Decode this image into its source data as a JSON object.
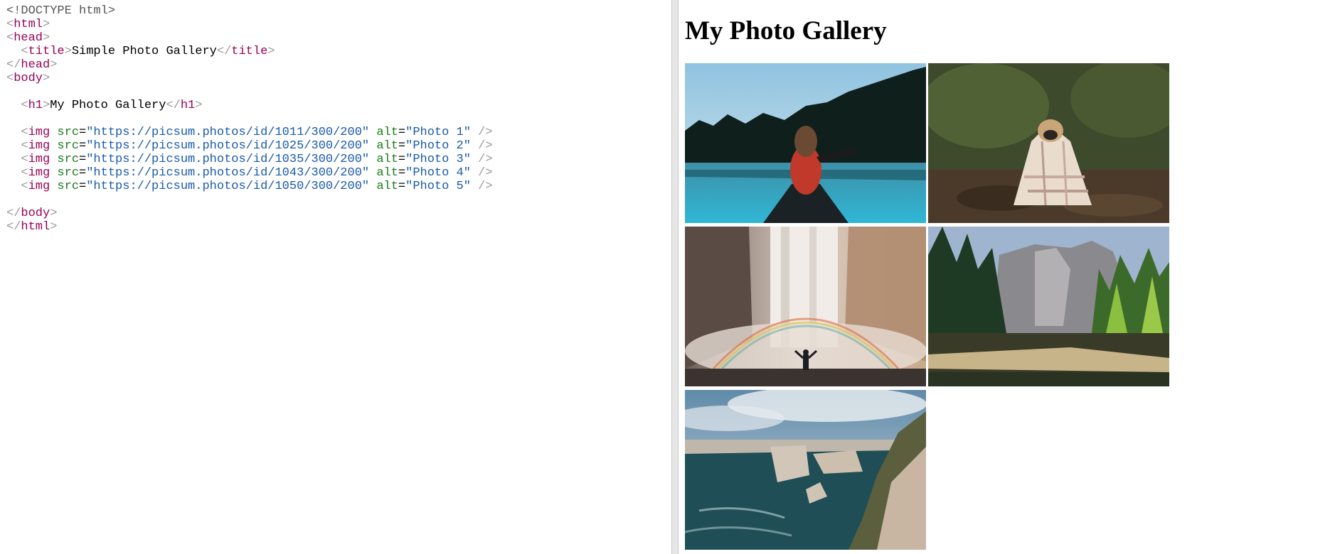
{
  "editor": {
    "lines": [
      [
        [
          "t-doc",
          "<!DOCTYPE html>"
        ]
      ],
      [
        [
          "t-br",
          "<"
        ],
        [
          "t-tag",
          "html"
        ],
        [
          "t-br",
          ">"
        ]
      ],
      [
        [
          "t-br",
          "<"
        ],
        [
          "t-tag",
          "head"
        ],
        [
          "t-br",
          ">"
        ]
      ],
      [
        [
          "t-txt",
          "  "
        ],
        [
          "t-br",
          "<"
        ],
        [
          "t-tag",
          "title"
        ],
        [
          "t-br",
          ">"
        ],
        [
          "t-txt",
          "Simple Photo Gallery"
        ],
        [
          "t-br",
          "</"
        ],
        [
          "t-tag",
          "title"
        ],
        [
          "t-br",
          ">"
        ]
      ],
      [
        [
          "t-br",
          "</"
        ],
        [
          "t-tag",
          "head"
        ],
        [
          "t-br",
          ">"
        ]
      ],
      [
        [
          "t-br",
          "<"
        ],
        [
          "t-tag",
          "body"
        ],
        [
          "t-br",
          ">"
        ]
      ],
      [
        [
          "t-txt",
          ""
        ]
      ],
      [
        [
          "t-txt",
          "  "
        ],
        [
          "t-br",
          "<"
        ],
        [
          "t-tag",
          "h1"
        ],
        [
          "t-br",
          ">"
        ],
        [
          "t-txt",
          "My Photo Gallery"
        ],
        [
          "t-br",
          "</"
        ],
        [
          "t-tag",
          "h1"
        ],
        [
          "t-br",
          ">"
        ]
      ],
      [
        [
          "t-txt",
          ""
        ]
      ],
      [
        [
          "t-txt",
          "  "
        ],
        [
          "t-br",
          "<"
        ],
        [
          "t-tag",
          "img"
        ],
        [
          "t-txt",
          " "
        ],
        [
          "t-attr",
          "src"
        ],
        [
          "t-txt",
          "="
        ],
        [
          "t-str",
          "\"https://picsum.photos/id/1011/300/200\""
        ],
        [
          "t-txt",
          " "
        ],
        [
          "t-attr",
          "alt"
        ],
        [
          "t-txt",
          "="
        ],
        [
          "t-str",
          "\"Photo 1\""
        ],
        [
          "t-txt",
          " "
        ],
        [
          "t-br",
          "/>"
        ]
      ],
      [
        [
          "t-txt",
          "  "
        ],
        [
          "t-br",
          "<"
        ],
        [
          "t-tag",
          "img"
        ],
        [
          "t-txt",
          " "
        ],
        [
          "t-attr",
          "src"
        ],
        [
          "t-txt",
          "="
        ],
        [
          "t-str",
          "\"https://picsum.photos/id/1025/300/200\""
        ],
        [
          "t-txt",
          " "
        ],
        [
          "t-attr",
          "alt"
        ],
        [
          "t-txt",
          "="
        ],
        [
          "t-str",
          "\"Photo 2\""
        ],
        [
          "t-txt",
          " "
        ],
        [
          "t-br",
          "/>"
        ]
      ],
      [
        [
          "t-txt",
          "  "
        ],
        [
          "t-br",
          "<"
        ],
        [
          "t-tag",
          "img"
        ],
        [
          "t-txt",
          " "
        ],
        [
          "t-attr",
          "src"
        ],
        [
          "t-txt",
          "="
        ],
        [
          "t-str",
          "\"https://picsum.photos/id/1035/300/200\""
        ],
        [
          "t-txt",
          " "
        ],
        [
          "t-attr",
          "alt"
        ],
        [
          "t-txt",
          "="
        ],
        [
          "t-str",
          "\"Photo 3\""
        ],
        [
          "t-txt",
          " "
        ],
        [
          "t-br",
          "/>"
        ]
      ],
      [
        [
          "t-txt",
          "  "
        ],
        [
          "t-br",
          "<"
        ],
        [
          "t-tag",
          "img"
        ],
        [
          "t-txt",
          " "
        ],
        [
          "t-attr",
          "src"
        ],
        [
          "t-txt",
          "="
        ],
        [
          "t-str",
          "\"https://picsum.photos/id/1043/300/200\""
        ],
        [
          "t-txt",
          " "
        ],
        [
          "t-attr",
          "alt"
        ],
        [
          "t-txt",
          "="
        ],
        [
          "t-str",
          "\"Photo 4\""
        ],
        [
          "t-txt",
          " "
        ],
        [
          "t-br",
          "/>"
        ]
      ],
      [
        [
          "t-txt",
          "  "
        ],
        [
          "t-br",
          "<"
        ],
        [
          "t-tag",
          "img"
        ],
        [
          "t-txt",
          " "
        ],
        [
          "t-attr",
          "src"
        ],
        [
          "t-txt",
          "="
        ],
        [
          "t-str",
          "\"https://picsum.photos/id/1050/300/200\""
        ],
        [
          "t-txt",
          " "
        ],
        [
          "t-attr",
          "alt"
        ],
        [
          "t-txt",
          "="
        ],
        [
          "t-str",
          "\"Photo 5\""
        ],
        [
          "t-txt",
          " "
        ],
        [
          "t-br",
          "/>"
        ]
      ],
      [
        [
          "t-txt",
          ""
        ]
      ],
      [
        [
          "t-br",
          "</"
        ],
        [
          "t-tag",
          "body"
        ],
        [
          "t-br",
          ">"
        ]
      ],
      [
        [
          "t-br",
          "</"
        ],
        [
          "t-tag",
          "html"
        ],
        [
          "t-br",
          ">"
        ]
      ]
    ]
  },
  "preview": {
    "heading": "My Photo Gallery",
    "photos": [
      {
        "alt": "Photo 1"
      },
      {
        "alt": "Photo 2"
      },
      {
        "alt": "Photo 3"
      },
      {
        "alt": "Photo 4"
      },
      {
        "alt": "Photo 5"
      }
    ]
  },
  "colors": {
    "tag": "#990055",
    "attribute": "#1a7a1a",
    "string": "#1a5aa8",
    "bracket": "#999999",
    "doctype": "#555555"
  }
}
